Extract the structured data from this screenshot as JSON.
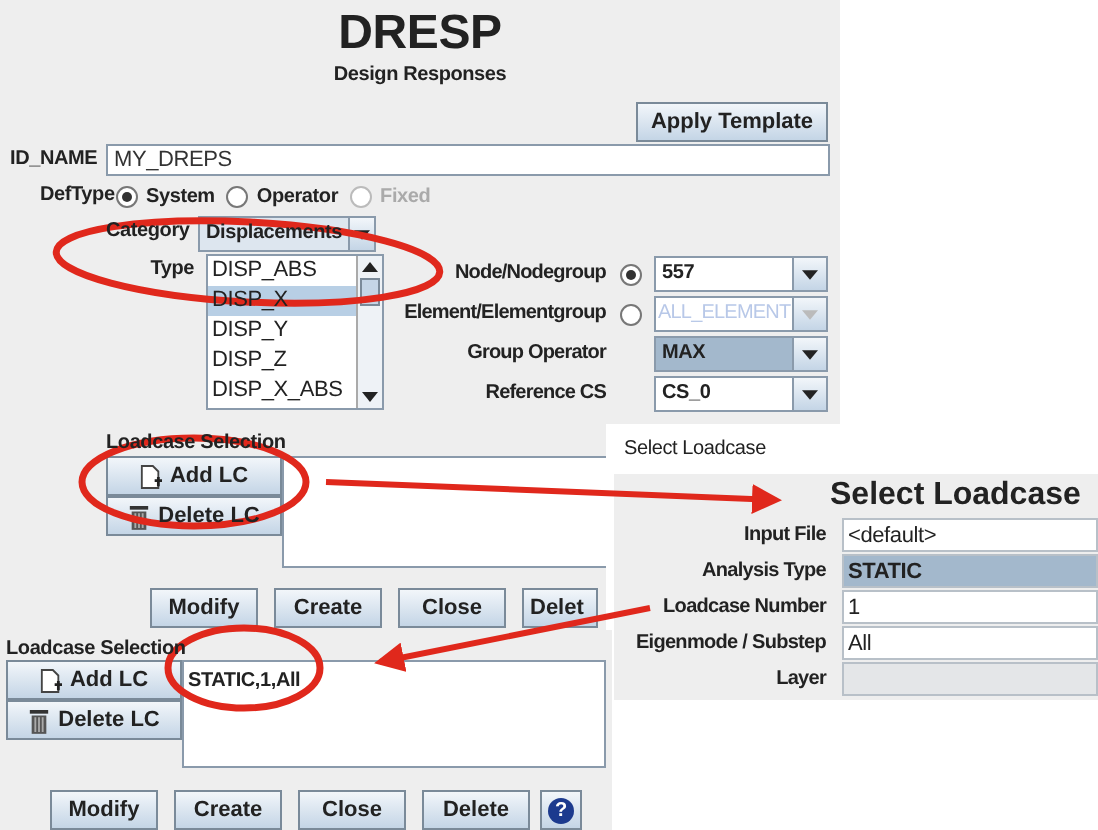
{
  "main_form": {
    "title": "DRESP",
    "subtitle": "Design Responses",
    "apply_button": "Apply Template",
    "id_name": {
      "label": "ID_NAME",
      "value": "MY_DREPS"
    },
    "def_type": {
      "label": "DefType",
      "options": [
        {
          "label": "System",
          "selected": true,
          "disabled": false
        },
        {
          "label": "Operator",
          "selected": false,
          "disabled": false
        },
        {
          "label": "Fixed",
          "selected": false,
          "disabled": true
        }
      ]
    },
    "category": {
      "label": "Category",
      "value": "Displacements"
    },
    "type": {
      "label": "Type",
      "items": [
        {
          "label": "DISP_ABS",
          "selected": false
        },
        {
          "label": "DISP_X",
          "selected": true
        },
        {
          "label": "DISP_Y",
          "selected": false
        },
        {
          "label": "DISP_Z",
          "selected": false
        },
        {
          "label": "DISP_X_ABS",
          "selected": false
        }
      ]
    },
    "target_rows": [
      {
        "kind": "radio_combo",
        "label": "Node/Nodegroup",
        "value": "557",
        "selected": true,
        "disabled": false,
        "highlighted": false
      },
      {
        "kind": "radio_combo",
        "label": "Element/Elementgroup",
        "value": "ALL_ELEMENT",
        "selected": false,
        "disabled": true,
        "highlighted": false
      },
      {
        "kind": "combo",
        "label": "Group Operator",
        "value": "MAX",
        "disabled": false,
        "highlighted": true
      },
      {
        "kind": "combo",
        "label": "Reference CS",
        "value": "CS_0",
        "disabled": false,
        "highlighted": false
      }
    ],
    "loadcase": {
      "label": "Loadcase Selection",
      "buttons": [
        {
          "kind": "add",
          "label": "Add LC"
        },
        {
          "kind": "delete",
          "label": "Delete LC"
        }
      ]
    },
    "actions": [
      "Modify",
      "Create",
      "Close",
      "Delet"
    ]
  },
  "loadcase_dialog": {
    "window_title": "Select Loadcase",
    "heading": "Select Loadcase",
    "fields": [
      {
        "kind": "text",
        "label": "Input File",
        "value": "<default>"
      },
      {
        "kind": "combo",
        "label": "Analysis Type",
        "value": "STATIC"
      },
      {
        "kind": "text",
        "label": "Loadcase Number",
        "value": "1"
      },
      {
        "kind": "text",
        "label": "Eigenmode / Substep",
        "value": "All"
      },
      {
        "kind": "disabled",
        "label": "Layer"
      }
    ]
  },
  "result_form": {
    "label": "Loadcase Selection",
    "buttons": [
      {
        "kind": "add",
        "label": "Add LC"
      },
      {
        "kind": "delete",
        "label": "Delete LC"
      }
    ],
    "selection": "STATIC,1,All",
    "actions": [
      "Modify",
      "Create",
      "Close",
      "Delete"
    ],
    "help": "?"
  }
}
